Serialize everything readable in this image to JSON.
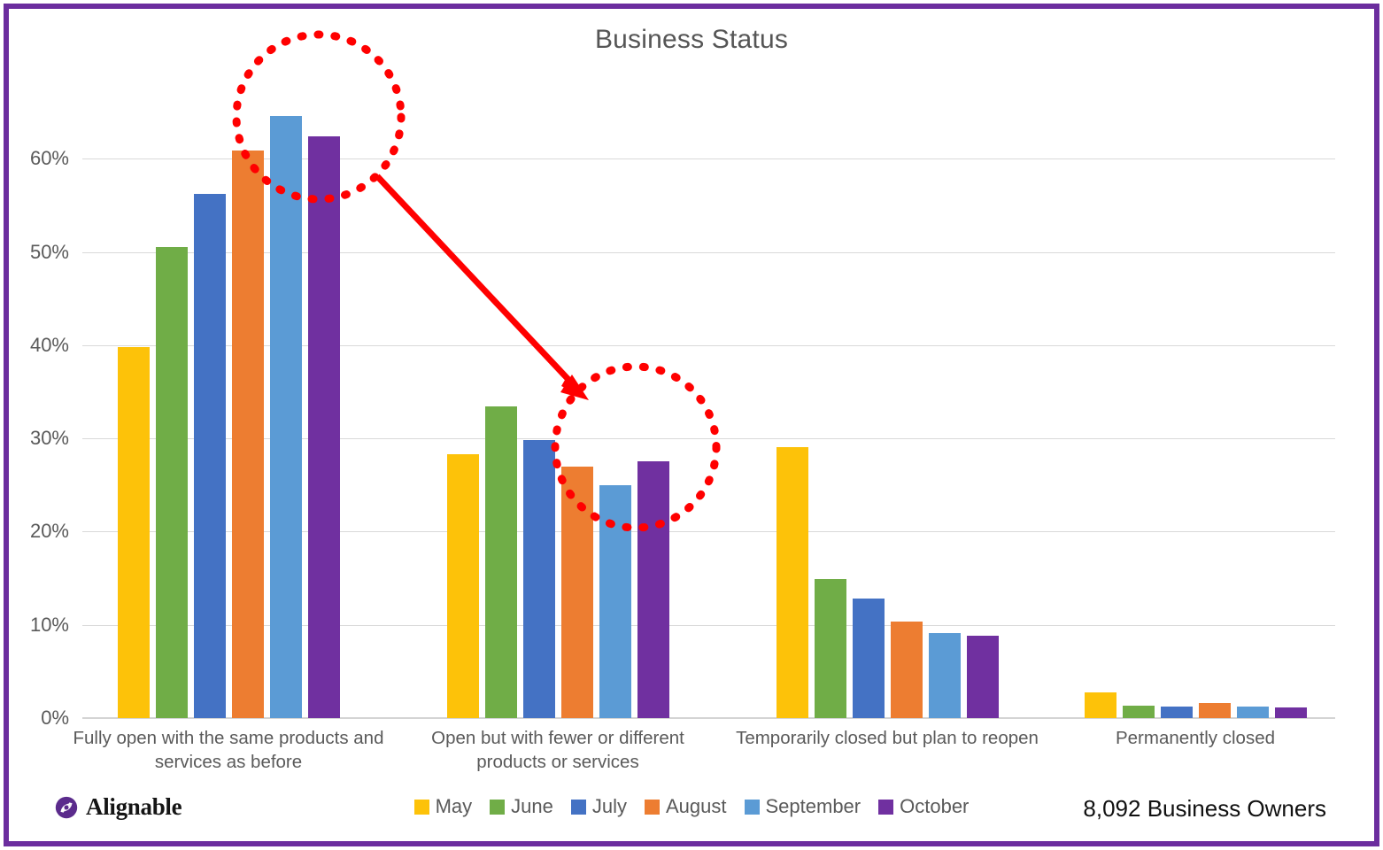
{
  "chart_data": {
    "type": "bar",
    "title": "Business Status",
    "xlabel": "",
    "ylabel": "",
    "ylim": [
      0,
      68
    ],
    "grid": true,
    "legend_position": "bottom-center",
    "ytick_labels": [
      "0%",
      "10%",
      "20%",
      "30%",
      "40%",
      "50%",
      "60%"
    ],
    "ytick_values": [
      0,
      10,
      20,
      30,
      40,
      50,
      60
    ],
    "categories": [
      "Fully open with the same products and services as before",
      "Open but with fewer or different products or services",
      "Temporarily closed but plan to reopen",
      "Permanently closed"
    ],
    "series": [
      {
        "name": "May",
        "color": "#FDC209",
        "values": [
          39.8,
          28.3,
          29.1,
          2.8
        ]
      },
      {
        "name": "June",
        "color": "#70AD47",
        "values": [
          50.5,
          33.4,
          14.9,
          1.3
        ]
      },
      {
        "name": "July",
        "color": "#4472C4",
        "values": [
          56.2,
          29.8,
          12.8,
          1.2
        ]
      },
      {
        "name": "August",
        "color": "#ED7D31",
        "values": [
          60.9,
          27.0,
          10.4,
          1.6
        ]
      },
      {
        "name": "September",
        "color": "#5B9BD5",
        "values": [
          64.6,
          25.0,
          9.1,
          1.2
        ]
      },
      {
        "name": "October",
        "color": "#7030A0",
        "values": [
          62.4,
          27.5,
          8.8,
          1.1
        ]
      }
    ],
    "annotations": [
      {
        "type": "circle",
        "label": "highlight-circle-fully-open",
        "note": "dotted red circle around Aug/Sep/Oct bars of Fully open group"
      },
      {
        "type": "circle",
        "label": "highlight-circle-open-fewer",
        "note": "dotted red circle around Aug/Sep/Oct bars of Open but fewer group"
      },
      {
        "type": "arrow",
        "label": "connector-arrow",
        "note": "red arrow from first circle to second circle"
      }
    ]
  },
  "xlabels": [
    {
      "line1": "Fully open with the same products and",
      "line2": "services as before"
    },
    {
      "line1": "Open but with fewer or different",
      "line2": "products or services"
    },
    {
      "line1": "Temporarily closed but plan to reopen",
      "line2": ""
    },
    {
      "line1": "Permanently closed",
      "line2": ""
    }
  ],
  "footer": {
    "brand_name": "Alignable",
    "respondents": "8,092 Business Owners"
  },
  "theme": {
    "frame_color": "#6B2D9E",
    "annotation_color": "#FF0000",
    "grid_color": "#D9D9D9",
    "text_color": "#5A5A5A",
    "background": "#FFFFFF"
  }
}
